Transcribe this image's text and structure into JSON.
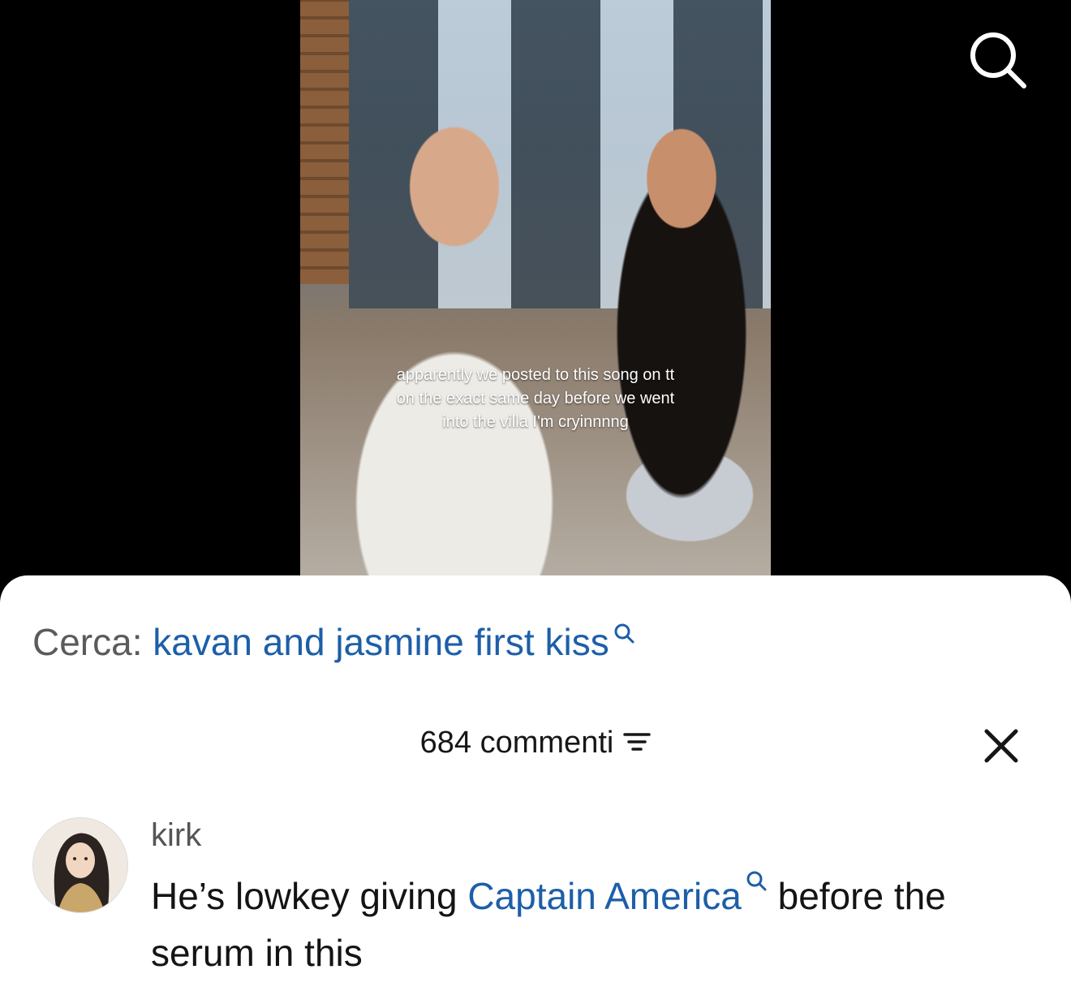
{
  "video": {
    "caption": "apparently we posted to this song on tt on the exact same day before we went into the villa I'm cryinnnng"
  },
  "search": {
    "prefix": "Cerca:",
    "query": "kavan and jasmine first kiss"
  },
  "comments": {
    "count_label": "684 commenti"
  },
  "comment": {
    "username": "kirk",
    "text_before": "He’s lowkey giving ",
    "mention": "Captain America",
    "text_after": " before the serum in this"
  },
  "colors": {
    "link": "#1d5fa8",
    "sheet_bg": "#ffffff",
    "page_bg": "#000000"
  },
  "icons": [
    "search-icon",
    "filter-icon",
    "close-icon",
    "search-mini-icon"
  ]
}
